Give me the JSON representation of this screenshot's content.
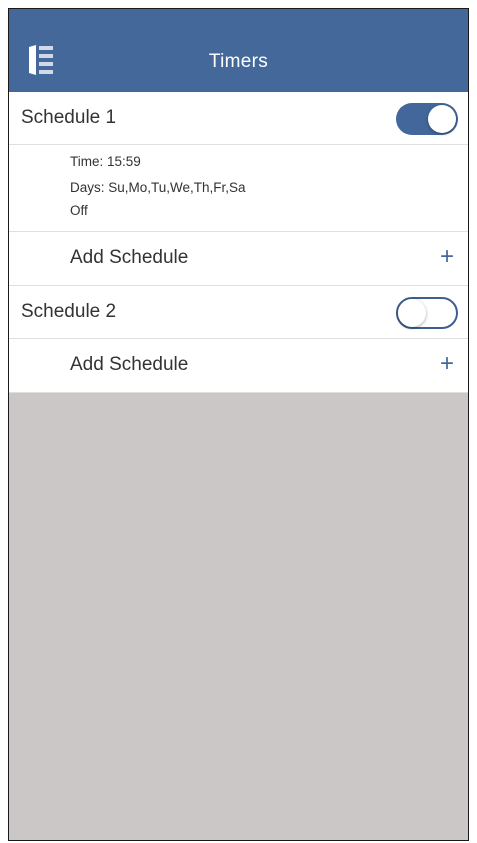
{
  "header": {
    "title": "Timers",
    "menu_icon": "list-menu-icon",
    "bar_color": "#44689a"
  },
  "schedules": [
    {
      "name": "Schedule 1",
      "enabled": true,
      "details": {
        "time": "Time: 15:59",
        "days": "Days: Su,Mo,Tu,We,Th,Fr,Sa",
        "action": "Off"
      },
      "add_label": "Add Schedule",
      "add_icon": "+"
    },
    {
      "name": "Schedule 2",
      "enabled": false,
      "add_label": "Add Schedule",
      "add_icon": "+"
    }
  ],
  "colors": {
    "accent": "#44689a",
    "background": "#cbc7c6",
    "toggle_on": "#43679a"
  }
}
